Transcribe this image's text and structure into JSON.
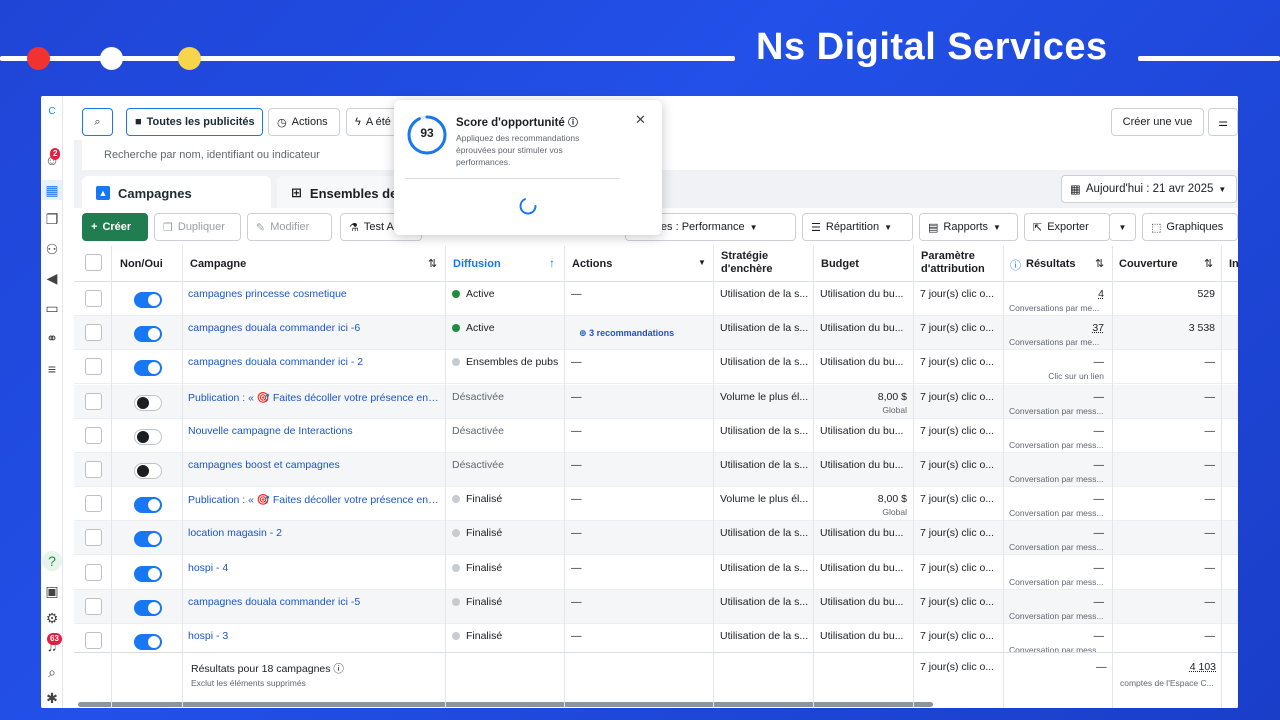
{
  "brand": "Ns Digital Services",
  "colors": {
    "accent": "#1877f2",
    "green": "#1f7d4f",
    "red_dot": "#f23131",
    "yellow_dot": "#f6d54a"
  },
  "rail": {
    "top_letter": "C",
    "badge_top": "2",
    "badge_bottom": "63",
    "help": "?"
  },
  "toolbar": {
    "search_icon": "search-icon",
    "all_ads": "Toutes les publicités",
    "actions": "Actions",
    "a_ete": "A été",
    "create_view": "Créer une vue"
  },
  "search": {
    "placeholder": "Recherche par nom, identifiant ou indicateur"
  },
  "tabs": {
    "campaigns": "Campagnes",
    "adsets": "Ensembles de p"
  },
  "date": "Aujourd'hui : 21 avr 2025",
  "actions_bar": {
    "create": "Créer",
    "duplicate": "Dupliquer",
    "modify": "Modifier",
    "test": "Test A",
    "columns": "olonnes : Performance",
    "breakdown": "Répartition",
    "reports": "Rapports",
    "export": "Exporter",
    "charts": "Graphiques"
  },
  "popover": {
    "score": "93",
    "title": "Score d'opportunité",
    "desc": "Appliquez des recommandations éprouvées pour stimuler vos performances."
  },
  "columns": {
    "onoff": "Non/Oui",
    "campaign": "Campagne",
    "delivery": "Diffusion",
    "actions": "Actions",
    "strategy": "Stratégie d'enchère",
    "budget": "Budget",
    "attribution": "Paramètre d'attribution",
    "results": "Résultats",
    "coverage": "Couverture",
    "more": "In"
  },
  "rows": [
    {
      "on": true,
      "name": "campagnes princesse cosmetique",
      "status": "Active",
      "dot": "#1e8e3e",
      "actions": "—",
      "strategy": "Utilisation de la s...",
      "budget": "Utilisation du bu...",
      "budget_sub": "",
      "attr": "7 jour(s) clic o...",
      "result": "4",
      "result_sub": "Conversations par me...",
      "coverage": "529"
    },
    {
      "on": true,
      "name": "campagnes douala commander ici -6",
      "status": "Active",
      "dot": "#1e8e3e",
      "actions": "3 recommandations",
      "strategy": "Utilisation de la s...",
      "budget": "Utilisation du bu...",
      "budget_sub": "",
      "attr": "7 jour(s) clic o...",
      "result": "37",
      "result_sub": "Conversations par me...",
      "coverage": "3 538"
    },
    {
      "on": true,
      "name": "campagnes douala commander ici - 2",
      "status": "Ensembles de pubs",
      "dot": "#c8ccd1",
      "actions": "—",
      "strategy": "Utilisation de la s...",
      "budget": "Utilisation du bu...",
      "budget_sub": "",
      "attr": "7 jour(s) clic o...",
      "result": "—",
      "result_sub": "Clic sur un lien",
      "coverage": "—"
    },
    {
      "on": false,
      "name": "Publication : « 🎯 Faites décoller votre présence en l...",
      "status": "Désactivée",
      "dot": "",
      "actions": "—",
      "strategy": "Volume le plus él...",
      "budget": "8,00 $",
      "budget_sub": "Global",
      "attr": "7 jour(s) clic o...",
      "result": "—",
      "result_sub": "Conversation par mess...",
      "coverage": "—"
    },
    {
      "on": false,
      "name": "Nouvelle campagne de Interactions",
      "status": "Désactivée",
      "dot": "",
      "actions": "—",
      "strategy": "Utilisation de la s...",
      "budget": "Utilisation du bu...",
      "budget_sub": "",
      "attr": "7 jour(s) clic o...",
      "result": "—",
      "result_sub": "Conversation par mess...",
      "coverage": "—"
    },
    {
      "on": false,
      "name": "campagnes boost et campagnes",
      "status": "Désactivée",
      "dot": "",
      "actions": "—",
      "strategy": "Utilisation de la s...",
      "budget": "Utilisation du bu...",
      "budget_sub": "",
      "attr": "7 jour(s) clic o...",
      "result": "—",
      "result_sub": "Conversation par mess...",
      "coverage": "—"
    },
    {
      "on": true,
      "name": "Publication : « 🎯 Faites décoller votre présence en l...",
      "status": "Finalisé",
      "dot": "#c8ccd1",
      "actions": "—",
      "strategy": "Volume le plus él...",
      "budget": "8,00 $",
      "budget_sub": "Global",
      "attr": "7 jour(s) clic o...",
      "result": "—",
      "result_sub": "Conversation par mess...",
      "coverage": "—"
    },
    {
      "on": true,
      "name": "location magasin - 2",
      "status": "Finalisé",
      "dot": "#c8ccd1",
      "actions": "—",
      "strategy": "Utilisation de la s...",
      "budget": "Utilisation du bu...",
      "budget_sub": "",
      "attr": "7 jour(s) clic o...",
      "result": "—",
      "result_sub": "Conversation par mess...",
      "coverage": "—"
    },
    {
      "on": true,
      "name": "hospi - 4",
      "status": "Finalisé",
      "dot": "#c8ccd1",
      "actions": "—",
      "strategy": "Utilisation de la s...",
      "budget": "Utilisation du bu...",
      "budget_sub": "",
      "attr": "7 jour(s) clic o...",
      "result": "—",
      "result_sub": "Conversation par mess...",
      "coverage": "—"
    },
    {
      "on": true,
      "name": "campagnes douala commander ici -5",
      "status": "Finalisé",
      "dot": "#c8ccd1",
      "actions": "—",
      "strategy": "Utilisation de la s...",
      "budget": "Utilisation du bu...",
      "budget_sub": "",
      "attr": "7 jour(s) clic o...",
      "result": "—",
      "result_sub": "Conversation par mess...",
      "coverage": "—"
    },
    {
      "on": true,
      "name": "hospi - 3",
      "status": "Finalisé",
      "dot": "#c8ccd1",
      "actions": "—",
      "strategy": "Utilisation de la s...",
      "budget": "Utilisation du bu...",
      "budget_sub": "",
      "attr": "7 jour(s) clic o...",
      "result": "—",
      "result_sub": "Conversation par mess...",
      "coverage": "—"
    }
  ],
  "footer": {
    "summary": "Résultats pour 18 campagnes",
    "note": "Exclut les éléments supprimés",
    "attr": "7 jour(s) clic o...",
    "result": "—",
    "coverage": "4 103",
    "coverage_sub": "comptes de l'Espace C..."
  }
}
